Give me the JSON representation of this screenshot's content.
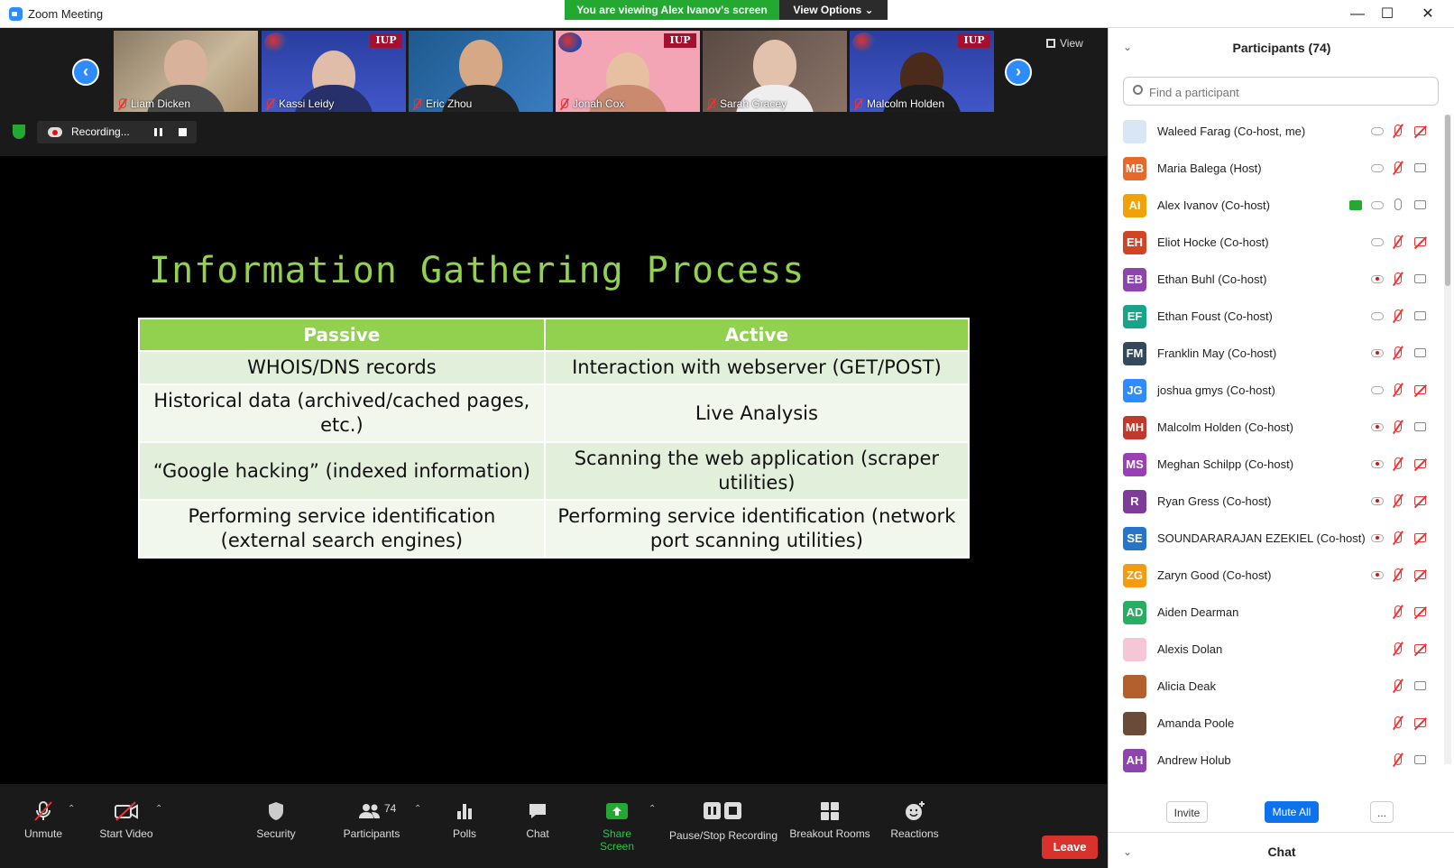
{
  "window": {
    "title": "Zoom Meeting",
    "minimize": "—",
    "maximize": "☐",
    "close": "✕"
  },
  "banner": {
    "viewing_text": "You are viewing Alex Ivanov's screen",
    "view_options_label": "View Options ⌄"
  },
  "gallery": {
    "prev_arrow": "‹",
    "next_arrow": "›",
    "view_label": "View",
    "tiles": [
      {
        "name": "Liam Dicken"
      },
      {
        "name": "Kassi Leidy",
        "iup": "IUP"
      },
      {
        "name": "Eric Zhou"
      },
      {
        "name": "Jonah Cox",
        "iup": "IUP"
      },
      {
        "name": "Sarah Gracey"
      },
      {
        "name": "Malcolm Holden",
        "iup": "IUP"
      }
    ]
  },
  "recording": {
    "label": "Recording..."
  },
  "slide": {
    "title": "Information Gathering Process",
    "headers": [
      "Passive",
      "Active"
    ],
    "rows": [
      [
        "WHOIS/DNS records",
        "Interaction with webserver (GET/POST)"
      ],
      [
        "Historical data (archived/cached pages, etc.)",
        "Live Analysis"
      ],
      [
        "“Google hacking” (indexed information)",
        "Scanning the web application (scraper utilities)"
      ],
      [
        "Performing service identification (external search engines)",
        "Performing service identification (network port scanning utilities)"
      ]
    ]
  },
  "toolbar": {
    "unmute": "Unmute",
    "start_video": "Start Video",
    "security": "Security",
    "participants": "Participants",
    "participants_count": "74",
    "polls": "Polls",
    "chat": "Chat",
    "share_screen": "Share Screen",
    "pause_stop_recording": "Pause/Stop Recording",
    "breakout_rooms": "Breakout Rooms",
    "reactions": "Reactions",
    "leave": "Leave",
    "caret": "⌃"
  },
  "panel": {
    "title": "Participants (74)",
    "collapse": "⌄",
    "search_placeholder": "Find a participant",
    "participants": [
      {
        "name": "Waleed Farag (Co-host, me)",
        "initials": "",
        "color": "#d9e6f5",
        "rec": false,
        "mic": "off",
        "cam": "off"
      },
      {
        "name": "Maria Balega (Host)",
        "initials": "MB",
        "color": "#e8672a",
        "rec": false,
        "mic": "off",
        "cam": "on"
      },
      {
        "name": "Alex Ivanov (Co-host)",
        "initials": "AI",
        "color": "#f0a20a",
        "share": true,
        "rec": false,
        "mic": "on",
        "cam": "on"
      },
      {
        "name": "Eliot Hocke (Co-host)",
        "initials": "EH",
        "color": "#d14424",
        "rec": false,
        "mic": "off",
        "cam": "off"
      },
      {
        "name": "Ethan Buhl (Co-host)",
        "initials": "EB",
        "color": "#8e44ad",
        "rec": true,
        "mic": "off",
        "cam": "on"
      },
      {
        "name": "Ethan Foust (Co-host)",
        "initials": "EF",
        "color": "#17a589",
        "rec": false,
        "mic": "off",
        "cam": "on"
      },
      {
        "name": "Franklin May (Co-host)",
        "initials": "FM",
        "color": "#34495e",
        "rec": true,
        "mic": "off",
        "cam": "on"
      },
      {
        "name": "joshua gmys (Co-host)",
        "initials": "JG",
        "color": "#2d8cff",
        "rec": false,
        "mic": "off",
        "cam": "off"
      },
      {
        "name": "Malcolm Holden (Co-host)",
        "initials": "MH",
        "color": "#c0392b",
        "rec": true,
        "mic": "off",
        "cam": "on"
      },
      {
        "name": "Meghan Schilpp (Co-host)",
        "initials": "MS",
        "color": "#9b3fb5",
        "rec": true,
        "mic": "off",
        "cam": "off"
      },
      {
        "name": "Ryan Gress (Co-host)",
        "initials": "R",
        "color": "#7d3c98",
        "rec": true,
        "mic": "off",
        "cam": "off"
      },
      {
        "name": "SOUNDARARAJAN EZEKIEL (Co-host)",
        "initials": "SE",
        "color": "#2874c8",
        "rec": true,
        "mic": "off",
        "cam": "off"
      },
      {
        "name": "Zaryn Good (Co-host)",
        "initials": "ZG",
        "color": "#f39c12",
        "rec": true,
        "mic": "off",
        "cam": "off"
      },
      {
        "name": "Aiden Dearman",
        "initials": "AD",
        "color": "#27ae60",
        "mic": "off",
        "cam": "off"
      },
      {
        "name": "Alexis Dolan",
        "initials": "",
        "color": "#f5c6d6",
        "mic": "off",
        "cam": "off"
      },
      {
        "name": "Alicia Deak",
        "initials": "",
        "color": "#b3602e",
        "mic": "off",
        "cam": "on"
      },
      {
        "name": "Amanda Poole",
        "initials": "",
        "color": "#6b4a3a",
        "mic": "off",
        "cam": "off"
      },
      {
        "name": "Andrew Holub",
        "initials": "AH",
        "color": "#8e44ad",
        "mic": "off",
        "cam": "on"
      }
    ],
    "invite": "Invite",
    "mute_all": "Mute All",
    "more": "...",
    "chat_title": "Chat"
  }
}
